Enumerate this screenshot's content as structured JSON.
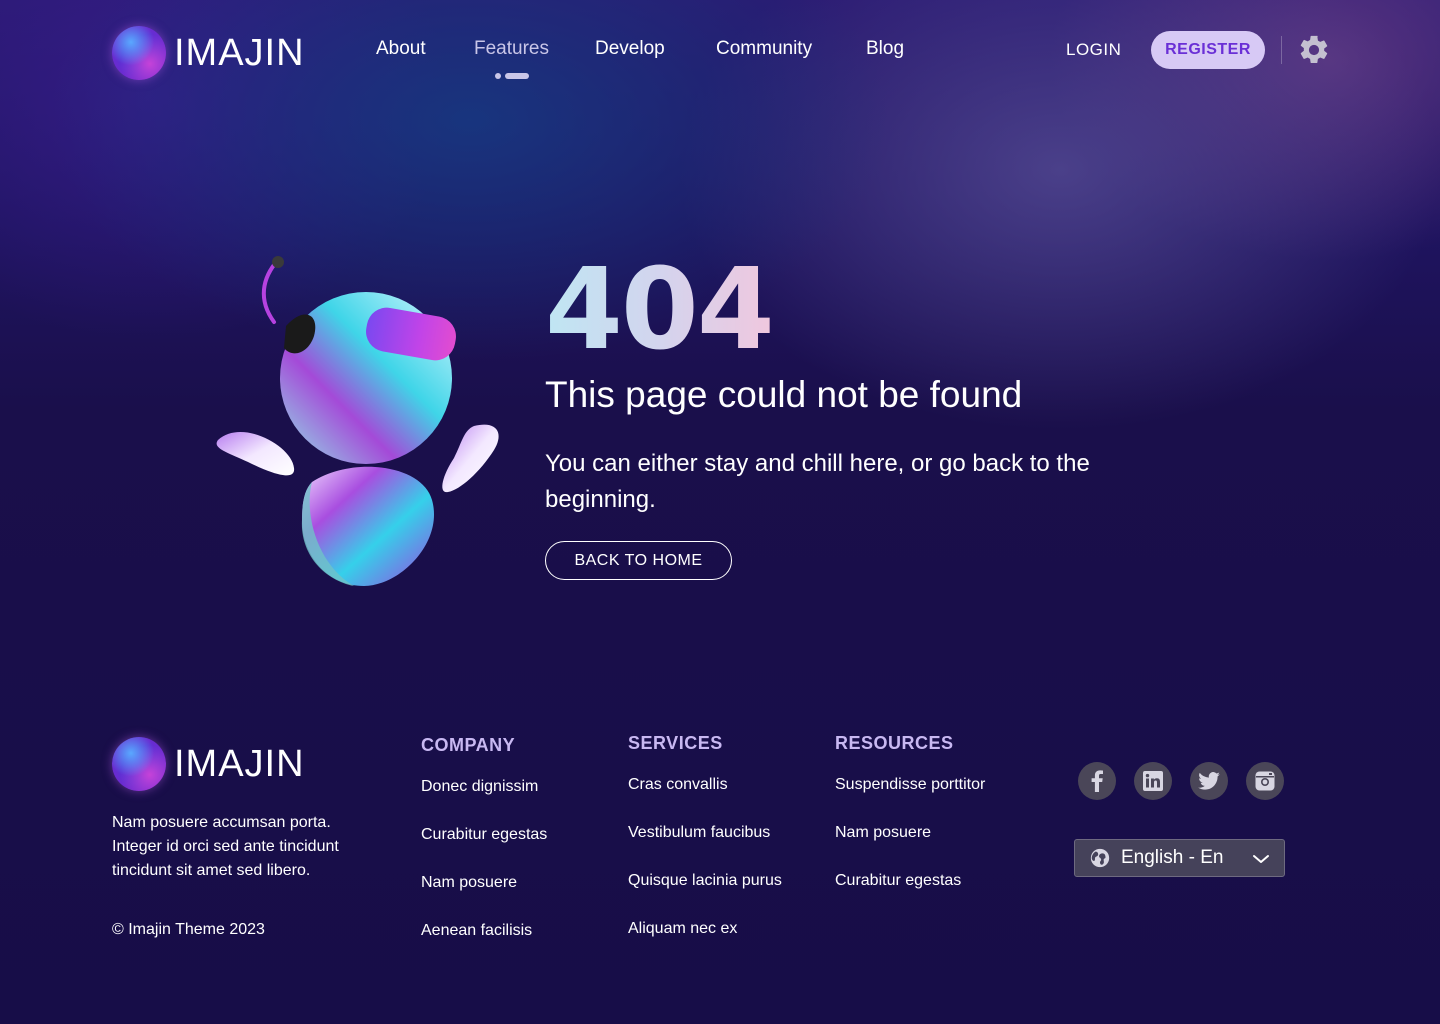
{
  "brand": {
    "name": "IMAJIN"
  },
  "nav": {
    "items": [
      "About",
      "Features",
      "Develop",
      "Community",
      "Blog"
    ],
    "active": "Features"
  },
  "auth": {
    "login_label": "LOGIN",
    "register_label": "REGISTER"
  },
  "hero": {
    "code": "404",
    "title": "This page could not be found",
    "description": "You can either stay and chill here, or go back to the beginning.",
    "button_label": "BACK TO HOME"
  },
  "footer": {
    "about": "Nam posuere accumsan porta. Integer id orci sed ante tincidunt tincidunt sit amet sed libero.",
    "copyright": "© Imajin Theme 2023",
    "columns": [
      {
        "title": "COMPANY",
        "links": [
          "Donec dignissim",
          "Curabitur egestas",
          "Nam posuere",
          "Aenean facilisis"
        ]
      },
      {
        "title": "SERVICES",
        "links": [
          "Cras convallis",
          "Vestibulum faucibus",
          "Quisque lacinia purus",
          "Aliquam nec ex"
        ]
      },
      {
        "title": "RESOURCES",
        "links": [
          "Suspendisse porttitor",
          "Nam posuere",
          "Curabitur egestas"
        ]
      }
    ],
    "socials": [
      "facebook-icon",
      "linkedin-icon",
      "twitter-icon",
      "instagram-icon"
    ],
    "language": "English - En"
  },
  "colors": {
    "background": "#1a0f4b",
    "accent": "#c8b8f2",
    "register_bg": "#d7c9f5",
    "register_text": "#6a2fd6"
  }
}
